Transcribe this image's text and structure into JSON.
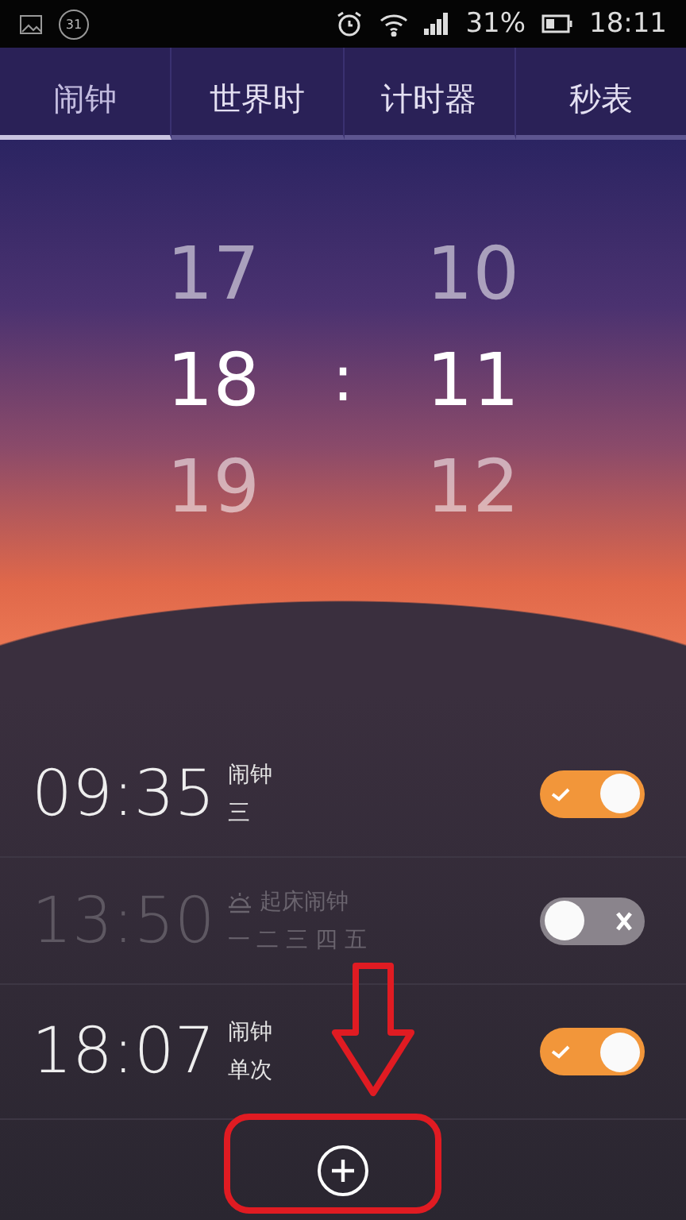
{
  "status_bar": {
    "calendar_day": "31",
    "battery": "31%",
    "time": "18:11"
  },
  "tabs": [
    {
      "label": "闹钟",
      "selected": true
    },
    {
      "label": "世界时",
      "selected": false
    },
    {
      "label": "计时器",
      "selected": false
    },
    {
      "label": "秒表",
      "selected": false
    }
  ],
  "picker": {
    "hours": [
      {
        "value": "17",
        "selected": false
      },
      {
        "value": "18",
        "selected": true
      },
      {
        "value": "19",
        "selected": false
      }
    ],
    "separator": ":",
    "minutes": [
      {
        "value": "10",
        "selected": false
      },
      {
        "value": "11",
        "selected": true
      },
      {
        "value": "12",
        "selected": false
      }
    ]
  },
  "alarms": [
    {
      "time": "09:35",
      "label": "闹钟",
      "repeat": "三",
      "kind": "plain",
      "on": true
    },
    {
      "time": "13:50",
      "label": "起床闹钟",
      "repeat": "一 二 三 四 五",
      "kind": "wake",
      "on": false
    },
    {
      "time": "18:07",
      "label": "闹钟",
      "repeat": "单次",
      "kind": "plain",
      "on": true
    }
  ]
}
